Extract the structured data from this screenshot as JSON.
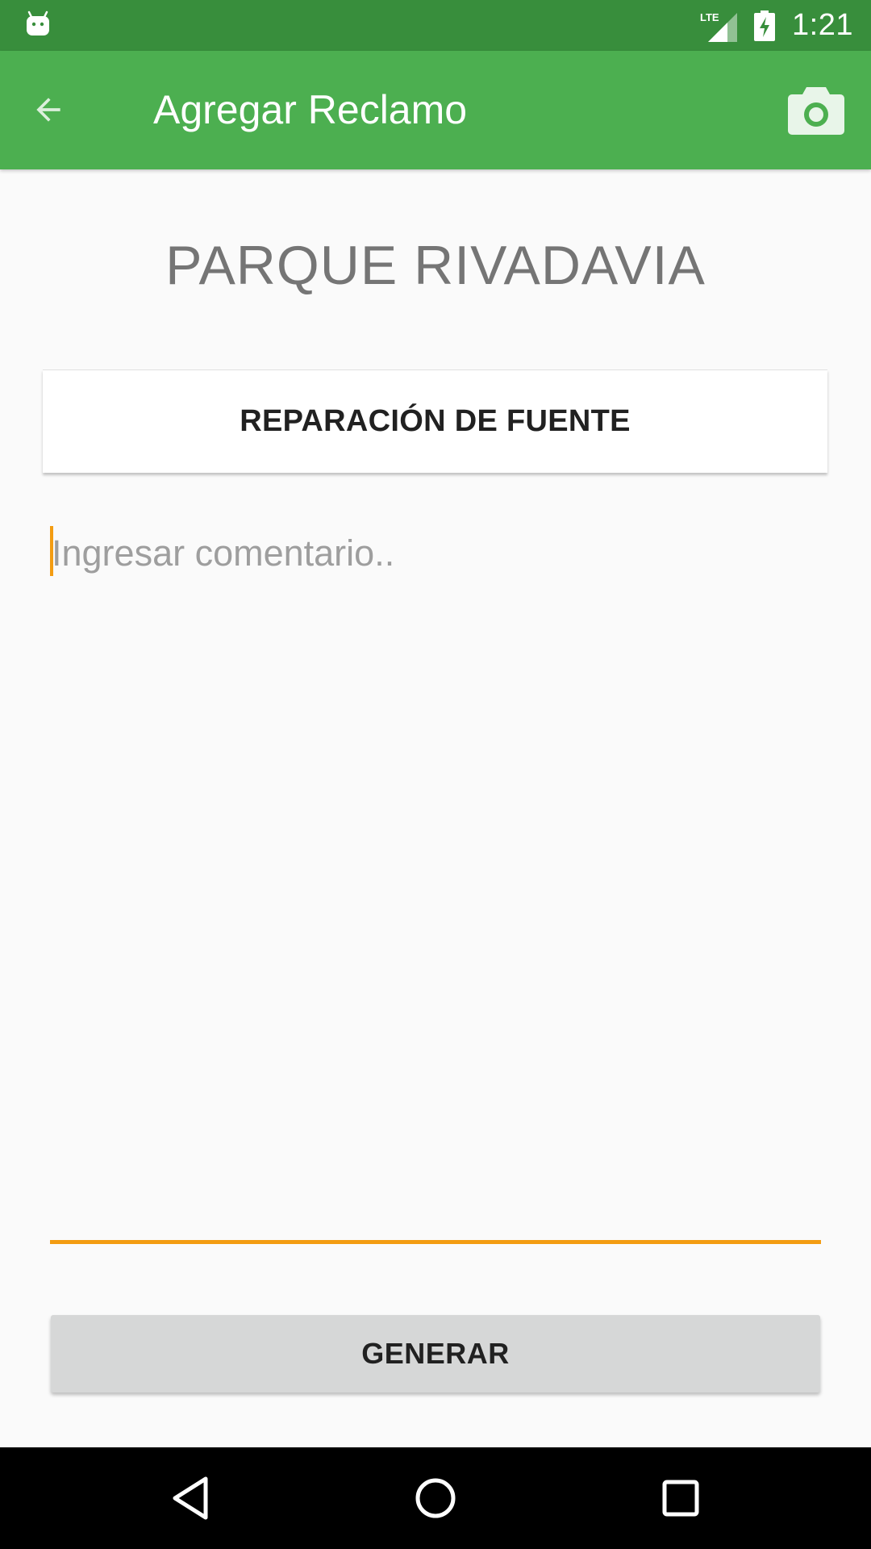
{
  "status_bar": {
    "time": "1:21",
    "network": "LTE",
    "icons": [
      "android-icon",
      "lte-signal-icon",
      "battery-charging-icon"
    ]
  },
  "app_bar": {
    "title": "Agregar Reclamo",
    "back_icon": "arrow-back-icon",
    "camera_icon": "camera-icon"
  },
  "content": {
    "place_name": "PARQUE RIVADAVIA",
    "claim_type": "REPARACIÓN DE FUENTE",
    "comment": {
      "value": "",
      "placeholder": "Ingresar comentario.."
    },
    "generate_label": "GENERAR"
  },
  "nav_bar": {
    "icons": [
      "nav-back-icon",
      "nav-home-icon",
      "nav-recents-icon"
    ]
  },
  "colors": {
    "status_bar": "#388e3c",
    "app_bar": "#4caf50",
    "accent": "#f39c12",
    "button": "#d6d7d7"
  }
}
